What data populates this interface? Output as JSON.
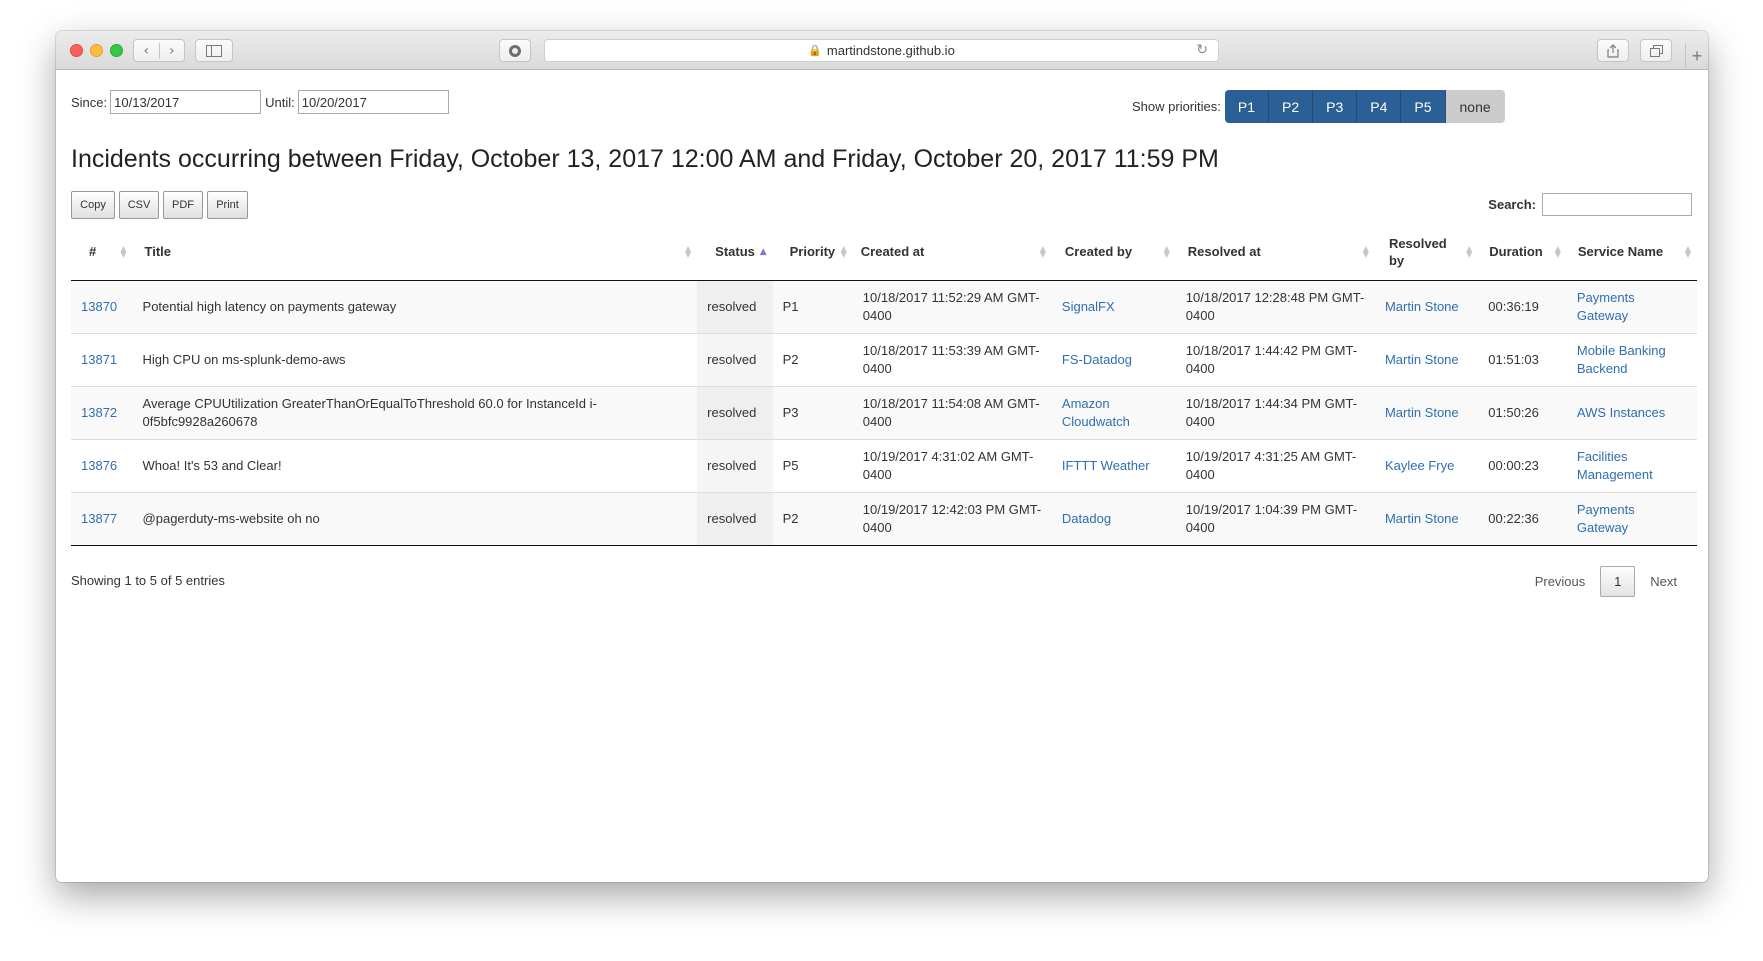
{
  "browser": {
    "url": "martindstone.github.io",
    "back_icon": "chevron-left",
    "forward_icon": "chevron-right",
    "new_tab_label": "+"
  },
  "filters": {
    "since_label": "Since:",
    "since_value": "10/13/2017",
    "until_label": "Until:",
    "until_value": "10/20/2017",
    "priorities_label": "Show priorities:",
    "priorities": [
      "P1",
      "P2",
      "P3",
      "P4",
      "P5",
      "none"
    ]
  },
  "page_title": "Incidents occurring between Friday, October 13, 2017 12:00 AM and Friday, October 20, 2017 11:59 PM",
  "export_buttons": [
    "Copy",
    "CSV",
    "PDF",
    "Print"
  ],
  "search": {
    "label": "Search:",
    "value": ""
  },
  "table": {
    "columns": [
      "#",
      "Title",
      "Status",
      "Priority",
      "Created at",
      "Created by",
      "Resolved at",
      "Resolved by",
      "Duration",
      "Service Name"
    ],
    "rows": [
      {
        "id": "13870",
        "title": "Potential high latency on payments gateway",
        "status": "resolved",
        "priority": "P1",
        "created_at": "10/18/2017 11:52:29 AM GMT-0400",
        "created_by": "SignalFX",
        "resolved_at": "10/18/2017 12:28:48 PM GMT-0400",
        "resolved_by": "Martin Stone",
        "duration": "00:36:19",
        "service": "Payments Gateway"
      },
      {
        "id": "13871",
        "title": "High CPU on ms-splunk-demo-aws",
        "status": "resolved",
        "priority": "P2",
        "created_at": "10/18/2017 11:53:39 AM GMT-0400",
        "created_by": "FS-Datadog",
        "resolved_at": "10/18/2017 1:44:42 PM GMT-0400",
        "resolved_by": "Martin Stone",
        "duration": "01:51:03",
        "service": "Mobile Banking Backend"
      },
      {
        "id": "13872",
        "title": "Average CPUUtilization GreaterThanOrEqualToThreshold 60.0 for InstanceId i-0f5bfc9928a260678",
        "status": "resolved",
        "priority": "P3",
        "created_at": "10/18/2017 11:54:08 AM GMT-0400",
        "created_by": "Amazon Cloudwatch",
        "resolved_at": "10/18/2017 1:44:34 PM GMT-0400",
        "resolved_by": "Martin Stone",
        "duration": "01:50:26",
        "service": "AWS Instances"
      },
      {
        "id": "13876",
        "title": "Whoa! It's 53 and Clear!",
        "status": "resolved",
        "priority": "P5",
        "created_at": "10/19/2017 4:31:02 AM GMT-0400",
        "created_by": "IFTTT Weather",
        "resolved_at": "10/19/2017 4:31:25 AM GMT-0400",
        "resolved_by": "Kaylee Frye",
        "duration": "00:00:23",
        "service": "Facilities Management"
      },
      {
        "id": "13877",
        "title": "@pagerduty-ms-website oh no",
        "status": "resolved",
        "priority": "P2",
        "created_at": "10/19/2017 12:42:03 PM GMT-0400",
        "created_by": "Datadog",
        "resolved_at": "10/19/2017 1:04:39 PM GMT-0400",
        "resolved_by": "Martin Stone",
        "duration": "00:22:36",
        "service": "Payments Gateway"
      }
    ]
  },
  "footer": {
    "info": "Showing 1 to 5 of 5 entries",
    "previous": "Previous",
    "current_page": "1",
    "next": "Next"
  },
  "colors": {
    "priority_button": "#2a6095",
    "link": "#2f6fb0",
    "none_button": "#cccccc"
  }
}
